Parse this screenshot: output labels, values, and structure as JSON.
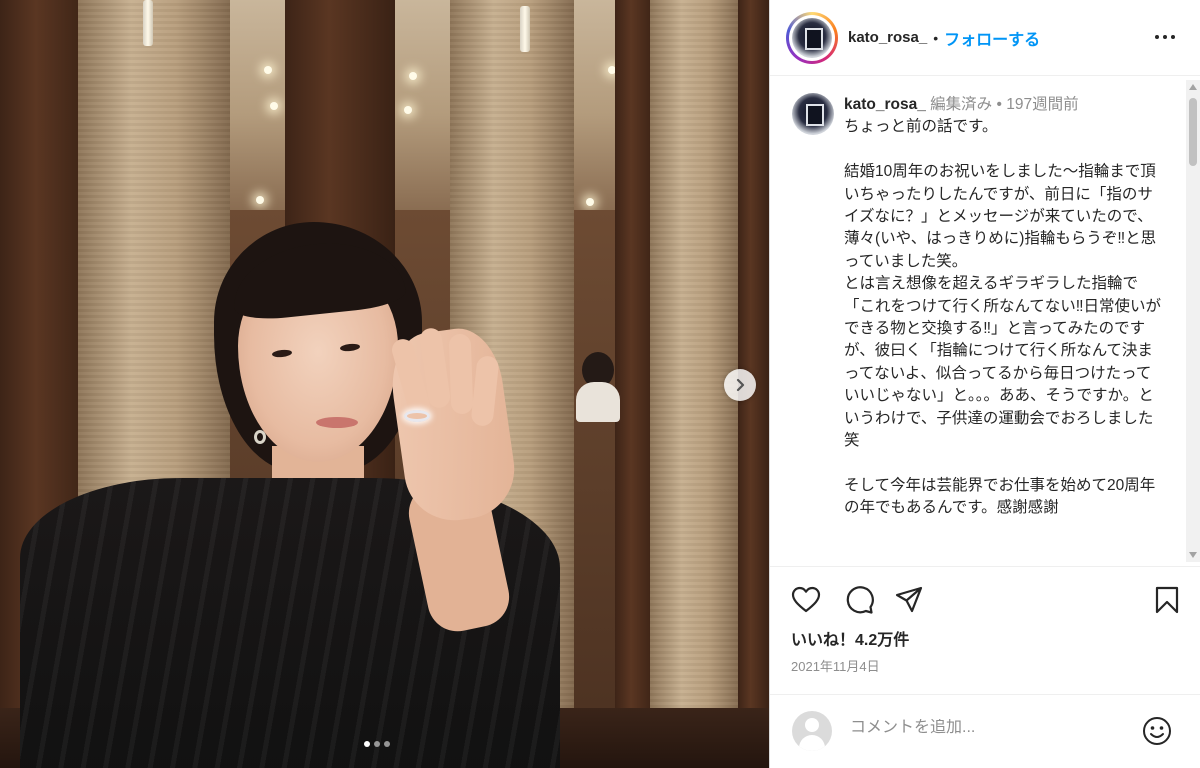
{
  "header": {
    "username": "kato_rosa_",
    "separator": "•",
    "follow_label": "フォローする"
  },
  "caption": {
    "username": "kato_rosa_",
    "meta": " 編集済み • 197週間前",
    "first_line": "ちょっと前の話です。",
    "body": "\n結婚10周年のお祝いをしました〜指輪まで頂いちゃったりしたんですが、前日に「指のサイズなに？」とメッセージが来ていたので、薄々(いや、はっきりめに)指輪もらうぞ‼︎と思っていました笑。\nとは言え想像を超えるギラギラした指輪で「これをつけて行く所なんてない‼︎日常使いができる物と交換する‼︎」と言ってみたのですが、彼曰く「指輪につけて行く所なんて決まってないよ、似合ってるから毎日つけたっていいじゃない」と。。。ああ、そうですか。というわけで、子供達の運動会でおろしました笑\n\nそして今年は芸能界でお仕事を始めて20周年の年でもあるんです。感謝感謝"
  },
  "engagement": {
    "likes": "いいね！4.2万件",
    "date": "2021年11月4日"
  },
  "comment": {
    "placeholder": "コメントを追加..."
  },
  "carousel": {
    "slides": 3,
    "active_index": 0
  },
  "colors": {
    "follow_blue": "#0095f6",
    "text": "#262626",
    "muted": "#8e8e8e"
  },
  "icons": [
    "heart-icon",
    "comment-icon",
    "share-icon",
    "bookmark-icon",
    "more-icon",
    "chevron-right-icon",
    "emoji-icon"
  ]
}
